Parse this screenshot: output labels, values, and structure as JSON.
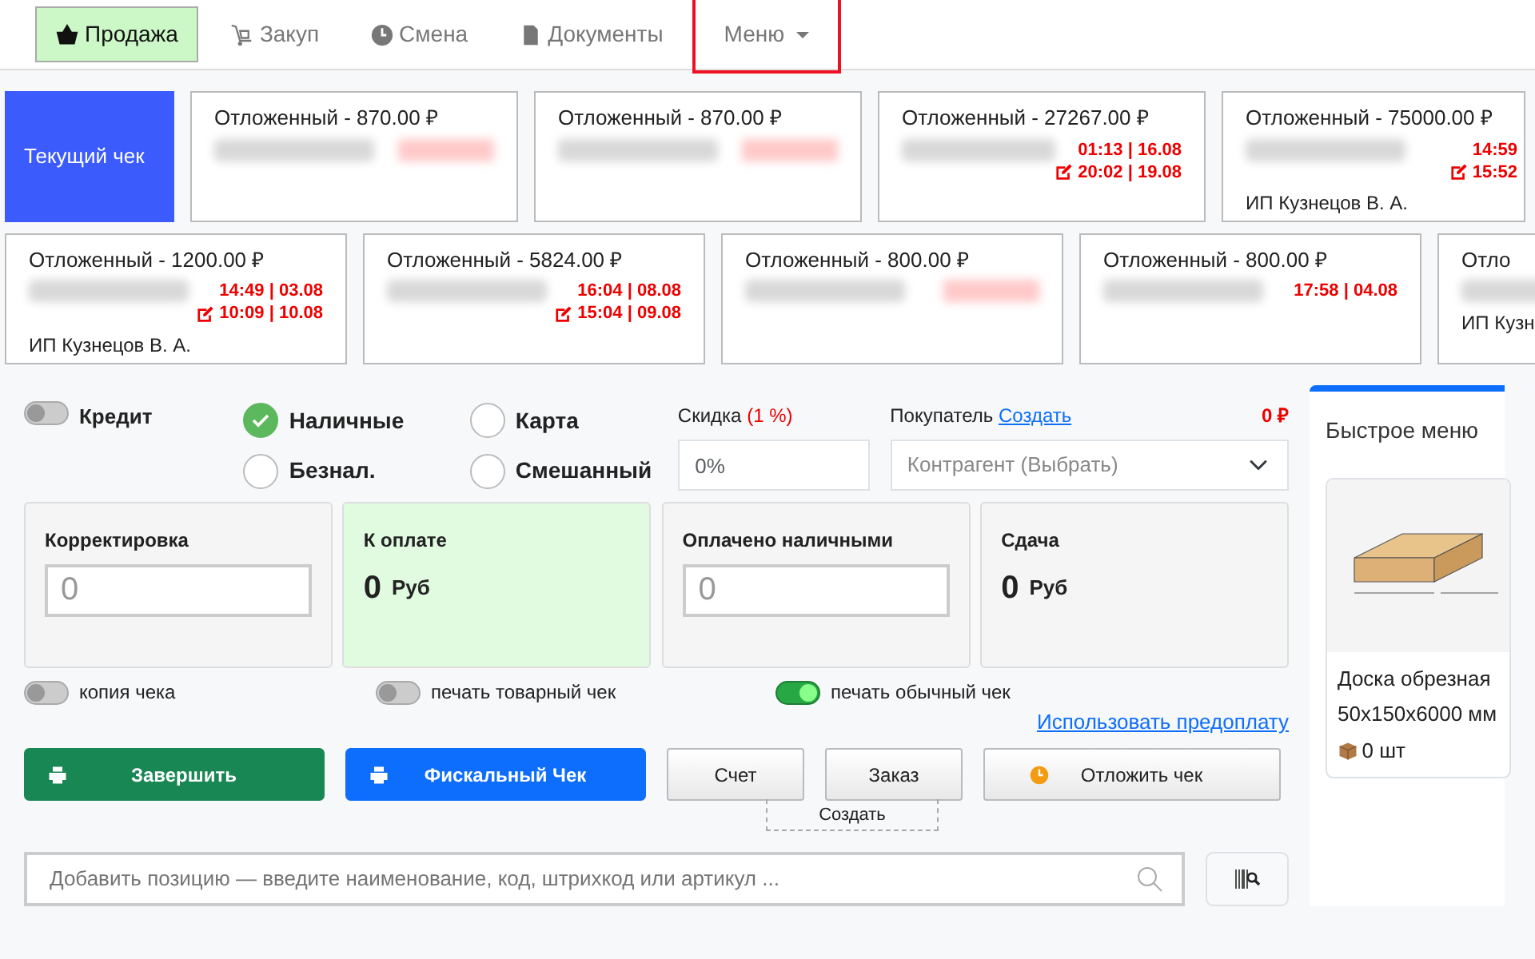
{
  "nav": {
    "items": [
      {
        "label": "Продажа",
        "selected": true
      },
      {
        "label": "Закуп",
        "selected": false
      },
      {
        "label": "Смена",
        "selected": false
      },
      {
        "label": "Документы",
        "selected": false
      }
    ],
    "menu": {
      "label": "Меню",
      "highlighted": true
    }
  },
  "held_checks": {
    "current": {
      "label": "Текущий чек",
      "selected": true
    },
    "rows": [
      [
        {
          "title": "Отложенный - 870.00 ₽",
          "time_hidden": true
        },
        {
          "title": "Отложенный - 870.00 ₽",
          "time_hidden": true
        },
        {
          "title": "Отложенный - 27267.00 ₽",
          "created": "01:13 | 16.08",
          "edited": "20:02 | 19.08",
          "time_hidden": false
        },
        {
          "title": "Отложенный - 75000.00 ₽",
          "created": "14:59",
          "edited": "15:52",
          "customer": "ИП Кузнецов В. А.",
          "time_hidden": false
        }
      ],
      [
        {
          "title": "Отложенный - 1200.00 ₽",
          "created": "14:49 | 03.08",
          "edited": "10:09 | 10.08",
          "customer": "ИП Кузнецов В. А.",
          "time_hidden": false
        },
        {
          "title": "Отложенный - 5824.00 ₽",
          "created": "16:04 | 08.08",
          "edited": "15:04 | 09.08",
          "time_hidden": false
        },
        {
          "title": "Отложенный - 800.00 ₽",
          "time_hidden": true
        },
        {
          "title": "Отложенный - 800.00 ₽",
          "created": "17:58 | 04.08",
          "time_hidden": false
        },
        {
          "title": "Отло",
          "customer": "ИП Кузн"
        }
      ]
    ]
  },
  "payment": {
    "credit": {
      "label": "Кредит",
      "on": false
    },
    "methods": [
      {
        "label": "Наличные",
        "selected": true
      },
      {
        "label": "Карта",
        "selected": false
      },
      {
        "label": "Безнал.",
        "selected": false
      },
      {
        "label": "Смешанный",
        "selected": false
      }
    ],
    "discount": {
      "label": "Скидка",
      "rate": "(1 %)",
      "placeholder": "0%"
    },
    "buyer": {
      "label": "Покупатель",
      "link": "Создать",
      "placeholder": "Контрагент (Выбрать)"
    },
    "total": "0 ₽",
    "boxes": [
      {
        "kind": "input",
        "label": "Корректировка",
        "placeholder": "0",
        "highlighted": false
      },
      {
        "kind": "amount",
        "label": "К оплате",
        "value": "0",
        "unit": "Руб",
        "highlighted": true
      },
      {
        "kind": "input",
        "label": "Оплачено наличными",
        "placeholder": "0",
        "highlighted": false
      },
      {
        "kind": "amount",
        "label": "Сдача",
        "value": "0",
        "unit": "Руб",
        "highlighted": false
      }
    ],
    "toggles": [
      {
        "label": "копия чека",
        "on": false
      },
      {
        "label": "печать товарный чек",
        "on": false
      },
      {
        "label": "печать обычный чек",
        "on": true
      }
    ],
    "prepay_link": "Использовать предоплату",
    "actions": [
      {
        "label": "Завершить",
        "kind": "success"
      },
      {
        "label": "Фискальный Чек",
        "kind": "primary"
      },
      {
        "label": "Счет",
        "kind": "light"
      },
      {
        "label": "Заказ",
        "kind": "light"
      },
      {
        "label": "Отложить чек",
        "kind": "light"
      }
    ],
    "create_label": "Создать",
    "search": {
      "placeholder": "Добавить позицию — введите наименование, код, штрихкод или артикул ..."
    }
  },
  "quick_menu": {
    "title": "Быстрое меню",
    "products": [
      {
        "name": "Доска обрезная",
        "size": "50x150x6000 мм",
        "stock": "0 шт"
      }
    ]
  }
}
